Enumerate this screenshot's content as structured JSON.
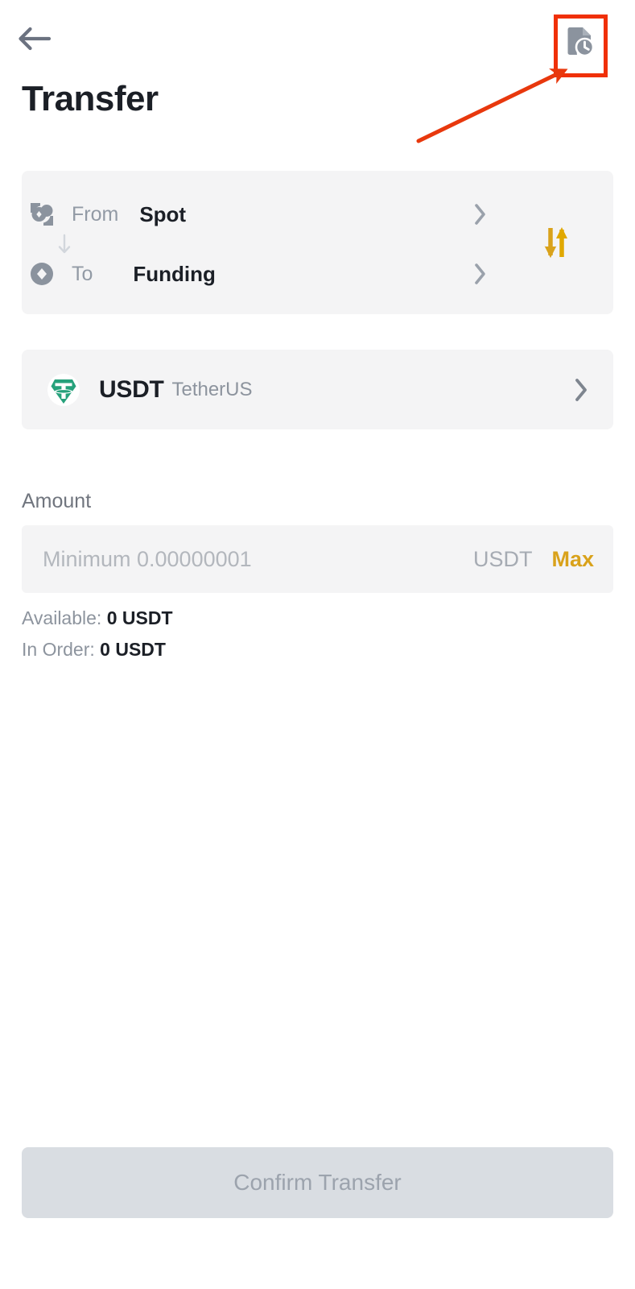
{
  "app": {
    "screen_title": "Transfer",
    "background": "#ffffff"
  },
  "header": {
    "back_icon": "arrow-left-icon",
    "history_icon": "document-clock-history-icon",
    "title": "Transfer"
  },
  "wallet_card": {
    "swap_icon": "swap-vertical-arrows-icon",
    "connector_icon": "arrow-down-icon",
    "rows": [
      {
        "icon": "spot-wallet-icon",
        "label": "From",
        "value": "Spot",
        "chevron": "chevron-right-icon"
      },
      {
        "icon": "funding-wallet-icon",
        "label": "To",
        "value": "Funding",
        "chevron": "chevron-right-icon"
      }
    ]
  },
  "coin_selector": {
    "logo_icon": "tether-usdt-logo-icon",
    "symbol": "USDT",
    "full_name": "TetherUS",
    "chevron": "chevron-right-icon"
  },
  "amount_section": {
    "label": "Amount",
    "input_value": "",
    "input_placeholder": "Minimum 0.00000001",
    "unit": "USDT",
    "max_label": "Max",
    "available_label": "Available:",
    "available_value": "0 USDT",
    "in_order_label": "In Order:",
    "in_order_value": "0 USDT"
  },
  "footer": {
    "confirm_label": "Confirm Transfer",
    "confirm_enabled": false
  },
  "colors": {
    "card_bg": "#f4f4f5",
    "accent_gold": "#d9a21b",
    "tether_green": "#26a17b",
    "text_primary": "#1b1f26",
    "text_muted": "#8d949e",
    "disabled_button_bg": "#d9dde2",
    "annotation_red": "#f03008"
  },
  "annotations": {
    "highlight_target": "document-clock-history-icon",
    "shapes": [
      "red-rectangle-highlight",
      "red-pointer-arrow"
    ]
  }
}
